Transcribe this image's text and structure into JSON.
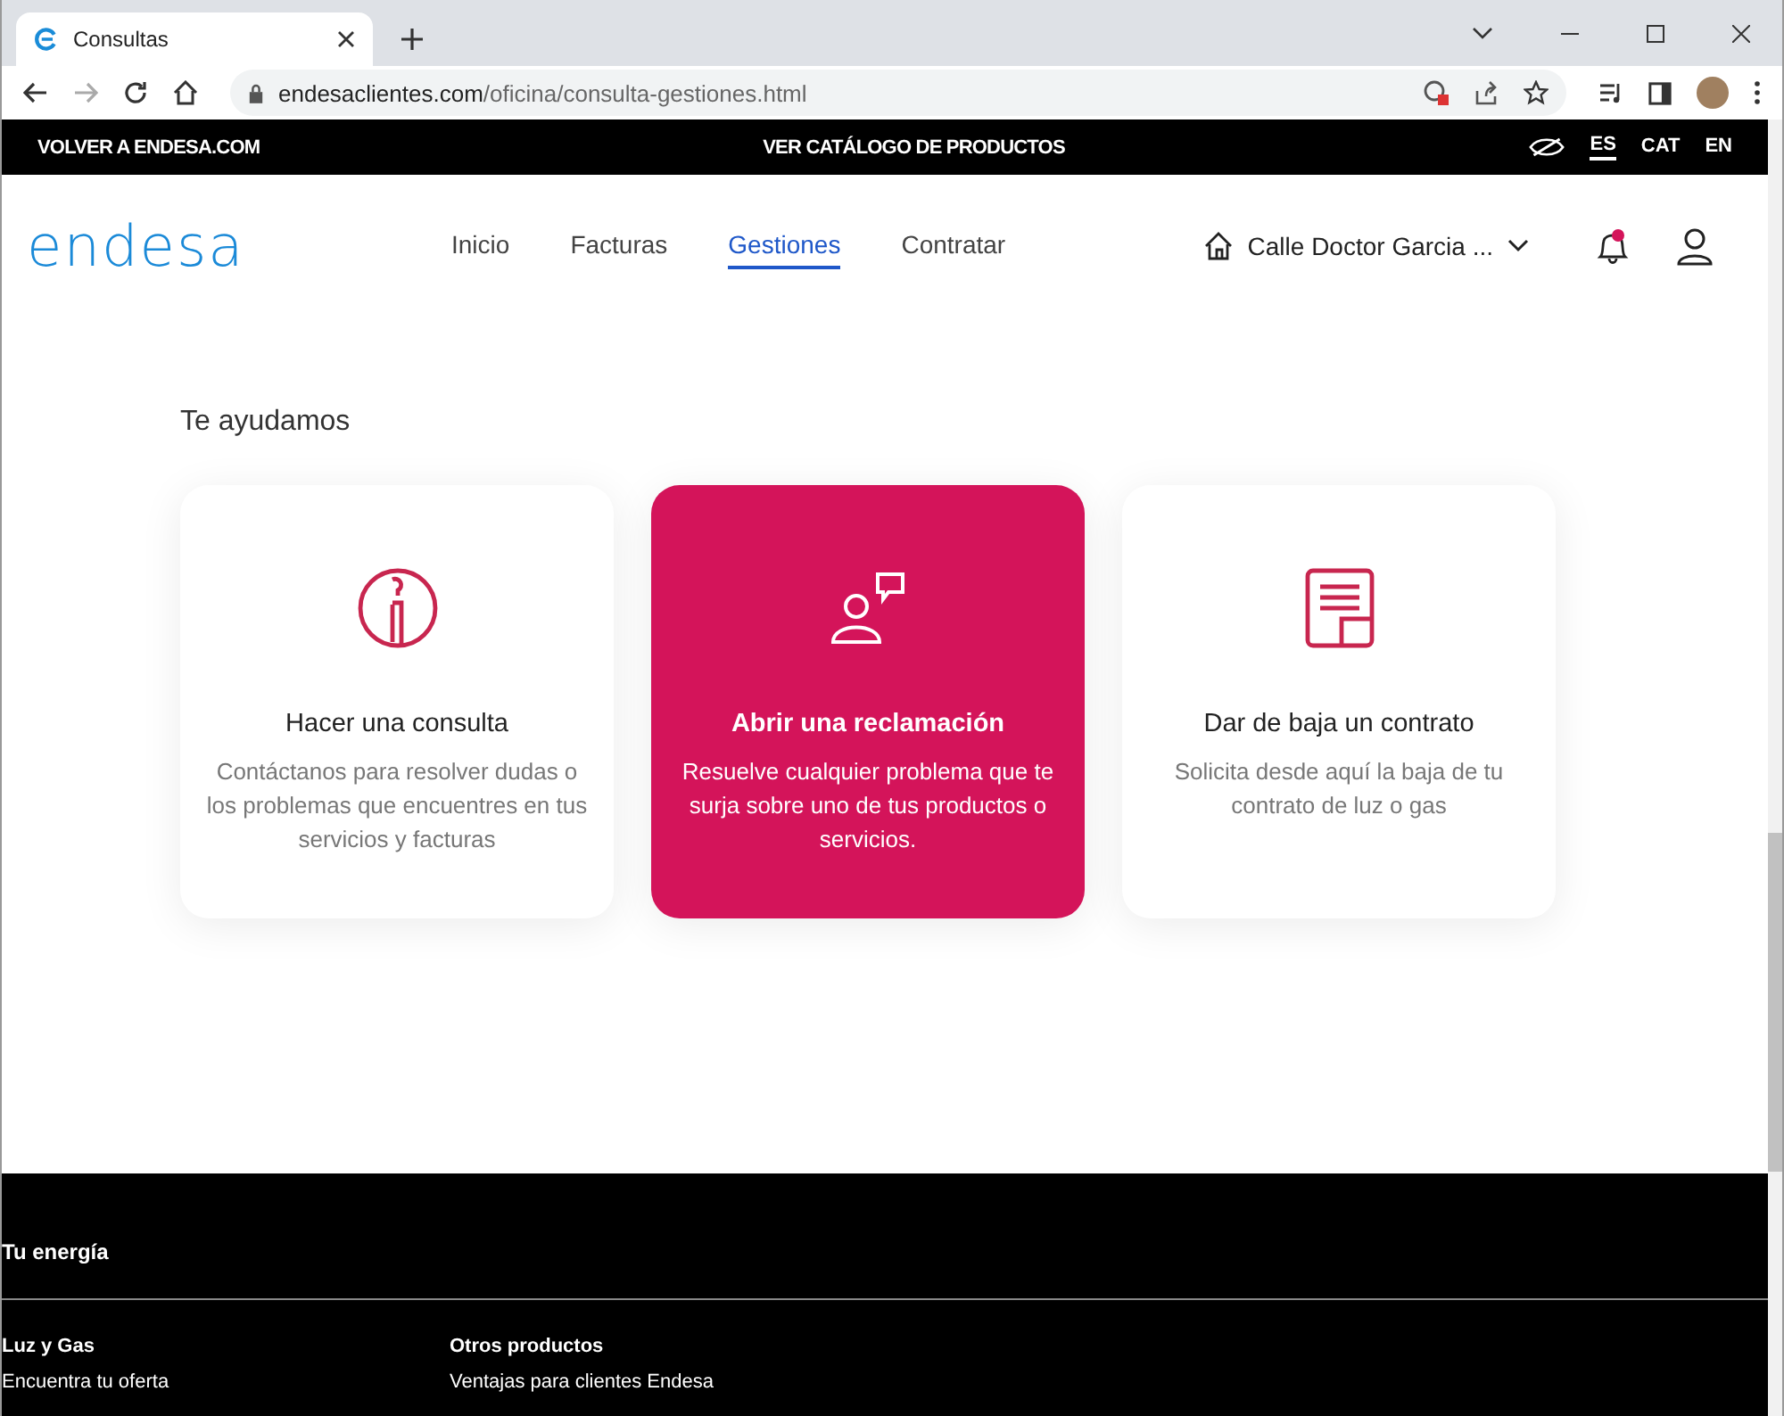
{
  "browser": {
    "tab_title": "Consultas",
    "url_host": "endesaclientes.com",
    "url_path": "/oficina/consulta-gestiones.html"
  },
  "top_bar": {
    "left_link": "VOLVER A ENDESA.COM",
    "center_link": "VER CATÁLOGO DE PRODUCTOS",
    "languages": [
      {
        "label": "ES",
        "selected": true
      },
      {
        "label": "CAT",
        "selected": false
      },
      {
        "label": "EN",
        "selected": false
      }
    ]
  },
  "header": {
    "logo": "endesa",
    "nav": [
      {
        "label": "Inicio",
        "selected": false
      },
      {
        "label": "Facturas",
        "selected": false
      },
      {
        "label": "Gestiones",
        "selected": true
      },
      {
        "label": "Contratar",
        "selected": false
      }
    ],
    "address": "Calle Doctor Garcia ...",
    "has_notification": true
  },
  "section_title": "Te ayudamos",
  "cards": [
    {
      "kind": "info",
      "title": "Hacer una consulta",
      "text": "Contáctanos para resolver dudas o los problemas que encuentres en tus servicios y facturas",
      "selected": false
    },
    {
      "kind": "complaint",
      "title": "Abrir una reclamación",
      "text": "Resuelve cualquier problema que te surja sobre uno de tus productos o servicios.",
      "selected": true
    },
    {
      "kind": "document",
      "title": "Dar de baja un contrato",
      "text": "Solicita desde aquí la baja de tu contrato de luz o gas",
      "selected": false
    }
  ],
  "footer": {
    "title": "Tu energía",
    "columns": [
      {
        "heading": "Luz y Gas",
        "links": [
          "Encuentra tu oferta"
        ]
      },
      {
        "heading": "Otros productos",
        "links": [
          "Ventajas para clientes Endesa"
        ]
      }
    ]
  }
}
